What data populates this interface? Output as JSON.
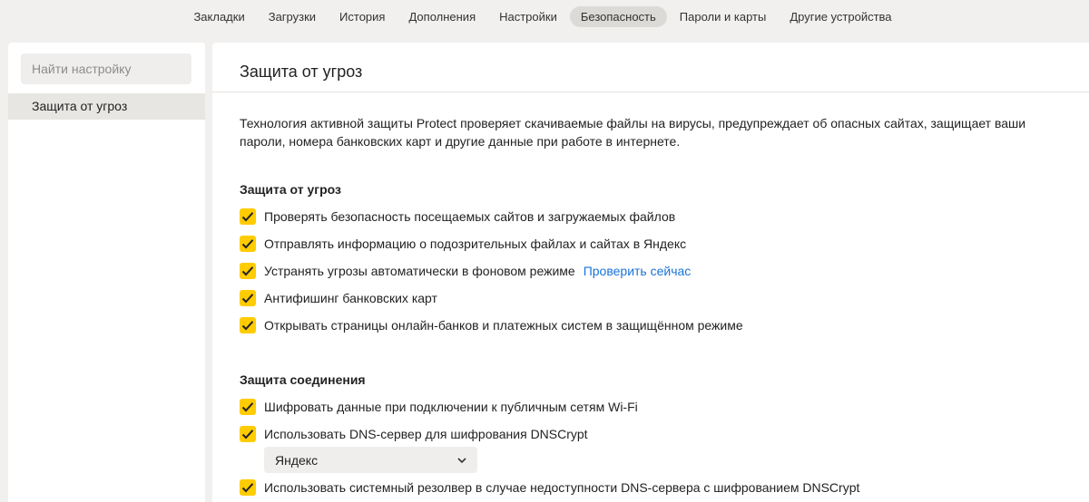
{
  "nav": {
    "tabs": [
      {
        "label": "Закладки"
      },
      {
        "label": "Загрузки"
      },
      {
        "label": "История"
      },
      {
        "label": "Дополнения"
      },
      {
        "label": "Настройки"
      },
      {
        "label": "Безопасность",
        "active": true
      },
      {
        "label": "Пароли и карты"
      },
      {
        "label": "Другие устройства"
      }
    ]
  },
  "sidebar": {
    "search_placeholder": "Найти настройку",
    "items": [
      {
        "label": "Защита от угроз",
        "selected": true
      }
    ]
  },
  "main": {
    "title": "Защита от угроз",
    "description": "Технология активной защиты Protect проверяет скачиваемые файлы на вирусы, предупреждает об опасных сайтах, защищает ваши пароли, номера банковских карт и другие данные при работе в интернете.",
    "sections": [
      {
        "title": "Защита от угроз",
        "options": [
          {
            "label": "Проверять безопасность посещаемых сайтов и загружаемых файлов",
            "checked": true
          },
          {
            "label": "Отправлять информацию о подозрительных файлах и сайтах в Яндекс",
            "checked": true
          },
          {
            "label": "Устранять угрозы автоматически в фоновом режиме",
            "checked": true,
            "link": "Проверить сейчас"
          },
          {
            "label": "Антифишинг банковских карт",
            "checked": true
          },
          {
            "label": "Открывать страницы онлайн-банков и платежных систем в защищённом режиме",
            "checked": true
          }
        ]
      },
      {
        "title": "Защита соединения",
        "options": [
          {
            "label": "Шифровать данные при подключении к публичным сетям Wi-Fi",
            "checked": true
          },
          {
            "label": "Использовать DNS-сервер для шифрования DNSCrypt",
            "checked": true
          },
          {
            "label": "Использовать системный резолвер в случае недоступности DNS-сервера с шифрованием DNSCrypt",
            "checked": true
          }
        ],
        "dns_select_value": "Яндекс"
      }
    ]
  },
  "colors": {
    "checkbox": "#ffcc00",
    "link": "#1a73d9",
    "background": "#f2f0ee"
  }
}
